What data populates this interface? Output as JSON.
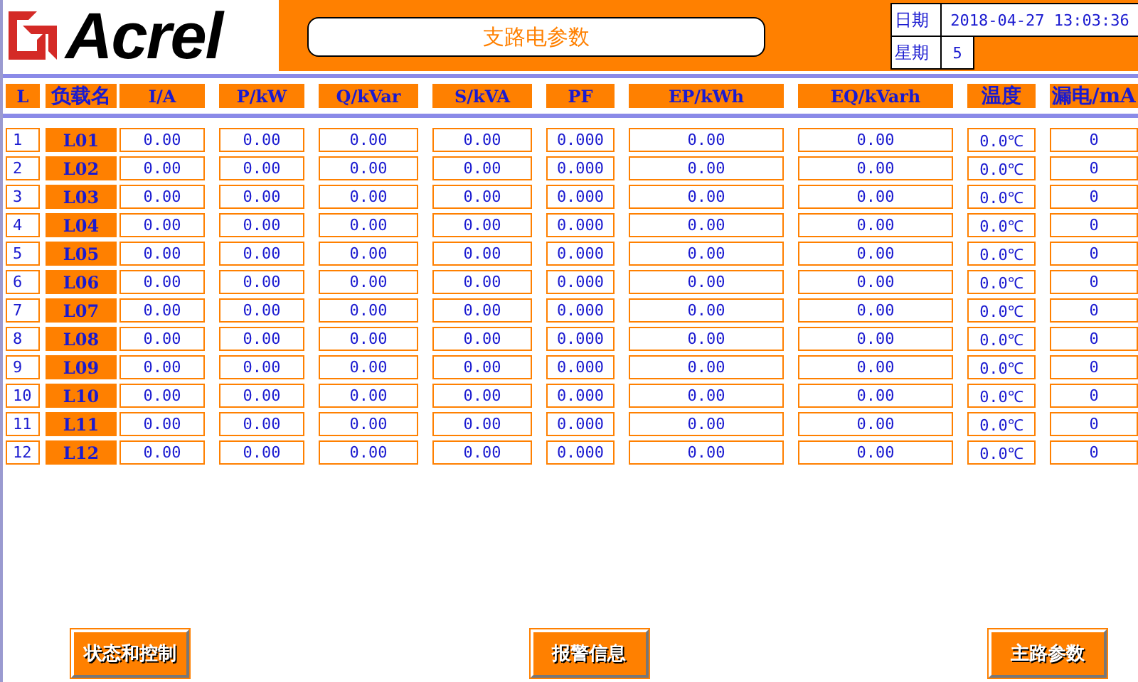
{
  "header": {
    "logo": "Acrel",
    "title": "支路电参数",
    "date_label": "日期",
    "date_value": "2018-04-27 13:03:36",
    "weekday_label": "星期",
    "weekday_value": "5"
  },
  "table": {
    "columns": [
      "L",
      "负载名",
      "I/A",
      "P/kW",
      "Q/kVar",
      "S/kVA",
      "PF",
      "EP/kWh",
      "EQ/kVarh",
      "温度",
      "漏电/mA"
    ],
    "rows": [
      {
        "index": "1",
        "name": "L01",
        "values": [
          "0.00",
          "0.00",
          "0.00",
          "0.00",
          "0.000",
          "0.00",
          "0.00",
          "0.0℃",
          "0"
        ]
      },
      {
        "index": "2",
        "name": "L02",
        "values": [
          "0.00",
          "0.00",
          "0.00",
          "0.00",
          "0.000",
          "0.00",
          "0.00",
          "0.0℃",
          "0"
        ]
      },
      {
        "index": "3",
        "name": "L03",
        "values": [
          "0.00",
          "0.00",
          "0.00",
          "0.00",
          "0.000",
          "0.00",
          "0.00",
          "0.0℃",
          "0"
        ]
      },
      {
        "index": "4",
        "name": "L04",
        "values": [
          "0.00",
          "0.00",
          "0.00",
          "0.00",
          "0.000",
          "0.00",
          "0.00",
          "0.0℃",
          "0"
        ]
      },
      {
        "index": "5",
        "name": "L05",
        "values": [
          "0.00",
          "0.00",
          "0.00",
          "0.00",
          "0.000",
          "0.00",
          "0.00",
          "0.0℃",
          "0"
        ]
      },
      {
        "index": "6",
        "name": "L06",
        "values": [
          "0.00",
          "0.00",
          "0.00",
          "0.00",
          "0.000",
          "0.00",
          "0.00",
          "0.0℃",
          "0"
        ]
      },
      {
        "index": "7",
        "name": "L07",
        "values": [
          "0.00",
          "0.00",
          "0.00",
          "0.00",
          "0.000",
          "0.00",
          "0.00",
          "0.0℃",
          "0"
        ]
      },
      {
        "index": "8",
        "name": "L08",
        "values": [
          "0.00",
          "0.00",
          "0.00",
          "0.00",
          "0.000",
          "0.00",
          "0.00",
          "0.0℃",
          "0"
        ]
      },
      {
        "index": "9",
        "name": "L09",
        "values": [
          "0.00",
          "0.00",
          "0.00",
          "0.00",
          "0.000",
          "0.00",
          "0.00",
          "0.0℃",
          "0"
        ]
      },
      {
        "index": "10",
        "name": "L10",
        "values": [
          "0.00",
          "0.00",
          "0.00",
          "0.00",
          "0.000",
          "0.00",
          "0.00",
          "0.0℃",
          "0"
        ]
      },
      {
        "index": "11",
        "name": "L11",
        "values": [
          "0.00",
          "0.00",
          "0.00",
          "0.00",
          "0.000",
          "0.00",
          "0.00",
          "0.0℃",
          "0"
        ]
      },
      {
        "index": "12",
        "name": "L12",
        "values": [
          "0.00",
          "0.00",
          "0.00",
          "0.00",
          "0.000",
          "0.00",
          "0.00",
          "0.0℃",
          "0"
        ]
      }
    ]
  },
  "buttons": [
    "状态和控制",
    "报警信息",
    "主路参数"
  ]
}
